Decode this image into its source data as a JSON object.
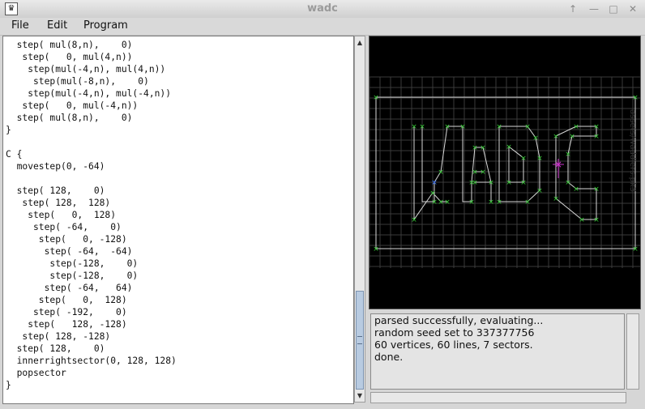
{
  "window": {
    "title": "wadc",
    "app_icon": "java-app-icon"
  },
  "menu": [
    {
      "label": "File"
    },
    {
      "label": "Edit"
    },
    {
      "label": "Program"
    }
  ],
  "editor": {
    "code": "  step( mul(8,n),    0)\n   step(   0, mul(4,n))\n    step(mul(-4,n), mul(4,n))\n     step(mul(-8,n),    0)\n    step(mul(-4,n), mul(-4,n))\n   step(   0, mul(-4,n))\n  step( mul(8,n),    0)\n}\n\nC {\n  movestep(0, -64)\n\n  step( 128,    0)\n   step( 128,  128)\n    step(   0,  128)\n     step( -64,    0)\n      step(   0, -128)\n       step( -64,  -64)\n        step(-128,    0)\n        step(-128,    0)\n       step( -64,   64)\n      step(   0,  128)\n     step( -192,    0)\n    step(   128, -128)\n   step( 128, -128)\n  step( 128,    0)\n  innerrightsector(0, 128, 128)\n  popsector\n}"
  },
  "map": {
    "colors": {
      "background": "#000000",
      "grid": "#3a3a3a",
      "lines": "#d8d8d8",
      "vertex": "#33cc33",
      "selected": "#cc33cc",
      "start": "#3355ff"
    },
    "watermark": "assets/waddlers.pk3"
  },
  "console": {
    "lines": [
      "parsed successfully, evaluating...",
      "random seed set to 337377756",
      "60 vertices, 60 lines, 7 sectors.",
      "done."
    ]
  }
}
